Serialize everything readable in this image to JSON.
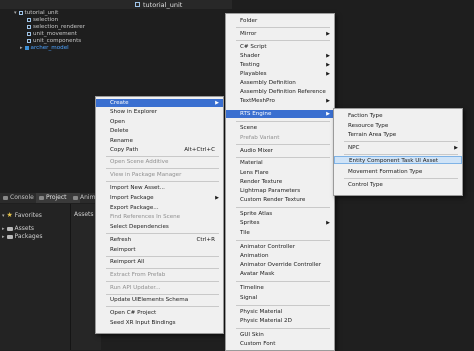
{
  "hierarchy": {
    "title": "tutorial_unit",
    "items": [
      {
        "label": "tutorial_unit"
      },
      {
        "label": "selection"
      },
      {
        "label": "selection_renderer"
      },
      {
        "label": "unit_movement"
      },
      {
        "label": "unit_components"
      },
      {
        "label": "archer_model"
      }
    ]
  },
  "project": {
    "tabs": [
      {
        "label": "Console"
      },
      {
        "label": "Project"
      },
      {
        "label": "Anim"
      }
    ],
    "favorites": "Favorites",
    "assets": "Assets",
    "packages": "Packages",
    "breadcrumb": "Assets"
  },
  "menu1": {
    "items": [
      {
        "label": "Create",
        "arrow": "▶"
      },
      {
        "label": "Show in Explorer"
      },
      {
        "label": "Open"
      },
      {
        "label": "Delete"
      },
      {
        "label": "Rename"
      },
      {
        "label": "Copy Path",
        "shortcut": "Alt+Ctrl+C"
      },
      {
        "label": "Open Scene Additive"
      },
      {
        "label": "View in Package Manager"
      },
      {
        "label": "Import New Asset..."
      },
      {
        "label": "Import Package",
        "arrow": "▶"
      },
      {
        "label": "Export Package..."
      },
      {
        "label": "Find References In Scene"
      },
      {
        "label": "Select Dependencies"
      },
      {
        "label": "Refresh",
        "shortcut": "Ctrl+R"
      },
      {
        "label": "Reimport"
      },
      {
        "label": "Reimport All"
      },
      {
        "label": "Extract From Prefab"
      },
      {
        "label": "Run API Updater..."
      },
      {
        "label": "Update UIElements Schema"
      },
      {
        "label": "Open C# Project"
      },
      {
        "label": "Seed XR Input Bindings"
      }
    ]
  },
  "menu2": {
    "items": [
      {
        "label": "Folder"
      },
      {
        "label": "Mirror",
        "arrow": "▶"
      },
      {
        "label": "C# Script"
      },
      {
        "label": "Shader",
        "arrow": "▶"
      },
      {
        "label": "Testing",
        "arrow": "▶"
      },
      {
        "label": "Playables",
        "arrow": "▶"
      },
      {
        "label": "Assembly Definition"
      },
      {
        "label": "Assembly Definition Reference"
      },
      {
        "label": "TextMeshPro",
        "arrow": "▶"
      },
      {
        "label": "RTS Engine",
        "arrow": "▶"
      },
      {
        "label": "Scene"
      },
      {
        "label": "Prefab Variant"
      },
      {
        "label": "Audio Mixer"
      },
      {
        "label": "Material"
      },
      {
        "label": "Lens Flare"
      },
      {
        "label": "Render Texture"
      },
      {
        "label": "Lightmap Parameters"
      },
      {
        "label": "Custom Render Texture"
      },
      {
        "label": "Sprite Atlas"
      },
      {
        "label": "Sprites",
        "arrow": "▶"
      },
      {
        "label": "Tile"
      },
      {
        "label": "Animator Controller"
      },
      {
        "label": "Animation"
      },
      {
        "label": "Animator Override Controller"
      },
      {
        "label": "Avatar Mask"
      },
      {
        "label": "Timeline"
      },
      {
        "label": "Signal"
      },
      {
        "label": "Physic Material"
      },
      {
        "label": "Physic Material 2D"
      },
      {
        "label": "GUI Skin"
      },
      {
        "label": "Custom Font"
      }
    ]
  },
  "menu3": {
    "items": [
      {
        "label": "Faction Type"
      },
      {
        "label": "Resource Type"
      },
      {
        "label": "Terrain Area Type"
      },
      {
        "label": "NPC",
        "arrow": "▶"
      },
      {
        "label": "Entity Component Task UI Asset"
      },
      {
        "label": "Movement Formation Type"
      },
      {
        "label": "Control Type"
      }
    ]
  }
}
